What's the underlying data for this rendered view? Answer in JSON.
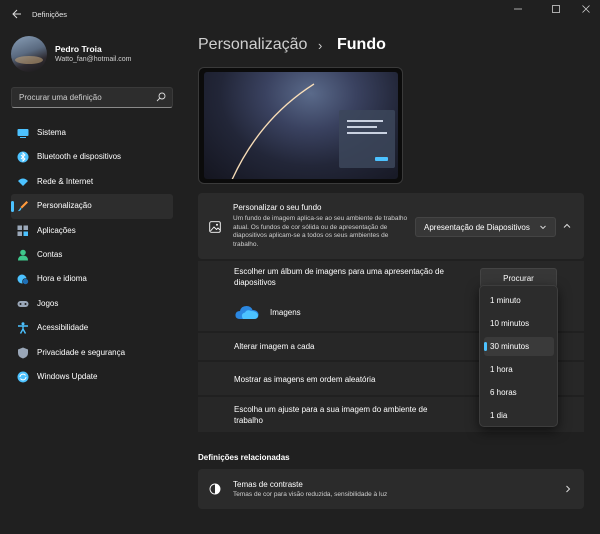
{
  "window": {
    "title": "Definições"
  },
  "user": {
    "name": "Pedro Troia",
    "email": "Watto_fan@hotmail.com"
  },
  "search": {
    "placeholder": "Procurar uma definição"
  },
  "sidebar": {
    "items": [
      {
        "label": "Sistema",
        "icon": "monitor-icon",
        "color": "#4cc2ff"
      },
      {
        "label": "Bluetooth e dispositivos",
        "icon": "bluetooth-icon",
        "color": "#4cc2ff"
      },
      {
        "label": "Rede & Internet",
        "icon": "wifi-icon",
        "color": "#4cc2ff"
      },
      {
        "label": "Personalização",
        "icon": "brush-icon",
        "color": "#ff9a3c",
        "active": true
      },
      {
        "label": "Aplicações",
        "icon": "apps-icon",
        "color": "#9aa7b8"
      },
      {
        "label": "Contas",
        "icon": "person-icon",
        "color": "#3ec98c"
      },
      {
        "label": "Hora e idioma",
        "icon": "globe-clock-icon",
        "color": "#4cc2ff"
      },
      {
        "label": "Jogos",
        "icon": "gamepad-icon",
        "color": "#9aa7b8"
      },
      {
        "label": "Acessibilidade",
        "icon": "accessibility-icon",
        "color": "#4cc2ff"
      },
      {
        "label": "Privacidade e segurança",
        "icon": "shield-icon",
        "color": "#9aa7b8"
      },
      {
        "label": "Windows Update",
        "icon": "update-icon",
        "color": "#4cc2ff"
      }
    ]
  },
  "breadcrumb": {
    "parent": "Personalização",
    "separator": "›",
    "current": "Fundo"
  },
  "background": {
    "title": "Personalizar o seu fundo",
    "description": "Um fundo de imagem aplica-se ao seu ambiente de trabalho atual. Os fundos de cor sólida ou de apresentação de diapositivos aplicam-se a todos os seus ambientes de trabalho.",
    "selected": "Apresentação de Diapositivos"
  },
  "slideshow": {
    "album_label": "Escolher um álbum de imagens para uma apresentação de diapositivos",
    "browse_label": "Procurar",
    "folder_name": "Imagens",
    "interval_label": "Alterar imagem a cada",
    "shuffle_label": "Mostrar as imagens em ordem aleatória",
    "fit_label": "Escolha um ajuste para a sua imagem do ambiente de trabalho"
  },
  "interval_options": [
    {
      "label": "1 minuto"
    },
    {
      "label": "10 minutos"
    },
    {
      "label": "30 minutos",
      "selected": true
    },
    {
      "label": "1 hora"
    },
    {
      "label": "6 horas"
    },
    {
      "label": "1 dia"
    }
  ],
  "related": {
    "heading": "Definições relacionadas",
    "item_title": "Temas de contraste",
    "item_desc": "Temas de cor para visão reduzida, sensibilidade à luz"
  },
  "accent_color": "#4cc2ff"
}
